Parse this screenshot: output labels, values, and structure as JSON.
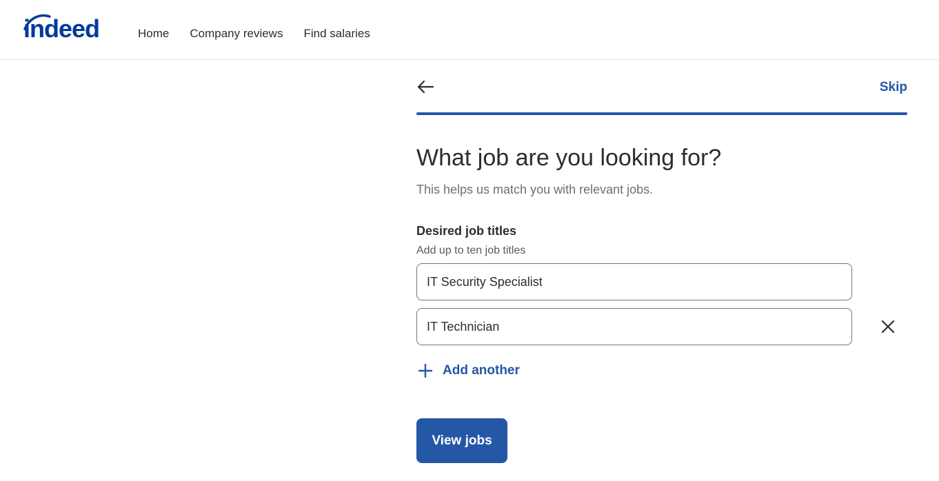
{
  "header": {
    "logo_text": "indeed",
    "nav": [
      {
        "label": "Home"
      },
      {
        "label": "Company reviews"
      },
      {
        "label": "Find salaries"
      }
    ]
  },
  "flow": {
    "skip_label": "Skip",
    "progress": 1.0,
    "title": "What job are you looking for?",
    "subtitle": "This helps us match you with relevant jobs."
  },
  "job_titles": {
    "label": "Desired job titles",
    "help": "Add up to ten job titles",
    "entries": [
      {
        "value": "IT Security Specialist"
      },
      {
        "value": "IT Technician"
      }
    ],
    "add_another_label": "Add another"
  },
  "actions": {
    "view_jobs_label": "View jobs"
  },
  "colors": {
    "brand": "#003a9b",
    "accent": "#2557a7",
    "text": "#2d2d2d",
    "muted": "#6f6f6f"
  },
  "icons": {
    "back": "arrow-left-icon",
    "clear": "close-icon",
    "add": "plus-icon"
  }
}
